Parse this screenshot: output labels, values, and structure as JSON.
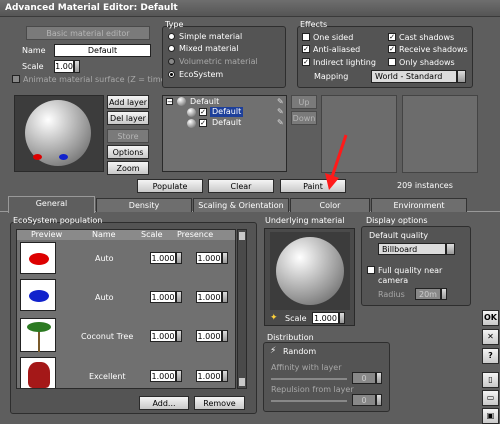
{
  "window": {
    "title": "Advanced Material Editor: Default"
  },
  "basic_editor_button": "Basic material editor",
  "name_label": "Name",
  "name_value": "Default",
  "scale_label": "Scale",
  "scale_value": "1.00",
  "animate_label": "Animate material surface (Z = time)",
  "type": {
    "title": "Type",
    "options": [
      "Simple material",
      "Mixed material",
      "Volumetric material",
      "EcoSystem"
    ],
    "selected": "EcoSystem"
  },
  "effects": {
    "title": "Effects",
    "one_sided": "One sided",
    "anti_aliased": "Anti-aliased",
    "indirect_lighting": "Indirect lighting",
    "cast_shadows": "Cast shadows",
    "receive_shadows": "Receive shadows",
    "only_shadows": "Only shadows",
    "mapping_label": "Mapping",
    "mapping_value": "World - Standard",
    "checked": [
      "Anti-aliased",
      "Indirect lighting",
      "Cast shadows",
      "Receive shadows"
    ]
  },
  "layer_buttons": {
    "add": "Add layer",
    "del": "Del layer",
    "store": "Store",
    "options": "Options",
    "zoom": "Zoom"
  },
  "tree": {
    "root": "Default",
    "children": [
      "Default",
      "Default"
    ]
  },
  "up_button": "Up",
  "down_button": "Down",
  "actions": {
    "populate": "Populate",
    "clear": "Clear",
    "paint": "Paint",
    "instances": "209 instances"
  },
  "tabs": [
    "General",
    "Density",
    "Scaling & Orientation",
    "Color",
    "Environment"
  ],
  "active_tab": "General",
  "population": {
    "title": "EcoSystem population",
    "columns": [
      "Preview",
      "Name",
      "Scale",
      "Presence"
    ],
    "rows": [
      {
        "name": "Auto",
        "scale": "1.000",
        "presence": "1.000",
        "preview": "red-object"
      },
      {
        "name": "Auto",
        "scale": "1.000",
        "presence": "1.000",
        "preview": "blue-object"
      },
      {
        "name": "Coconut Tree",
        "scale": "1.000",
        "presence": "1.000",
        "preview": "palm-tree"
      },
      {
        "name": "Excellent",
        "scale": "1.000",
        "presence": "1.000",
        "preview": "red-plant"
      }
    ],
    "add_button": "Add...",
    "remove_button": "Remove"
  },
  "underlying": {
    "title": "Underlying material",
    "scale_label": "Scale",
    "scale_value": "1.000"
  },
  "display_options": {
    "title": "Display options",
    "default_quality_label": "Default quality",
    "quality_value": "Billboard",
    "full_quality_label": "Full quality near camera",
    "radius_label": "Radius",
    "radius_value": "20m"
  },
  "distribution": {
    "title": "Distribution",
    "random_label": "Random",
    "affinity_label": "Affinity with layer",
    "affinity_value": "0",
    "repulsion_label": "Repulsion from layer",
    "repulsion_value": "0"
  },
  "side_buttons": {
    "ok": "OK",
    "close": "✕",
    "help": "?"
  },
  "colors": {
    "annotation_arrow": "#ff1a1a"
  }
}
